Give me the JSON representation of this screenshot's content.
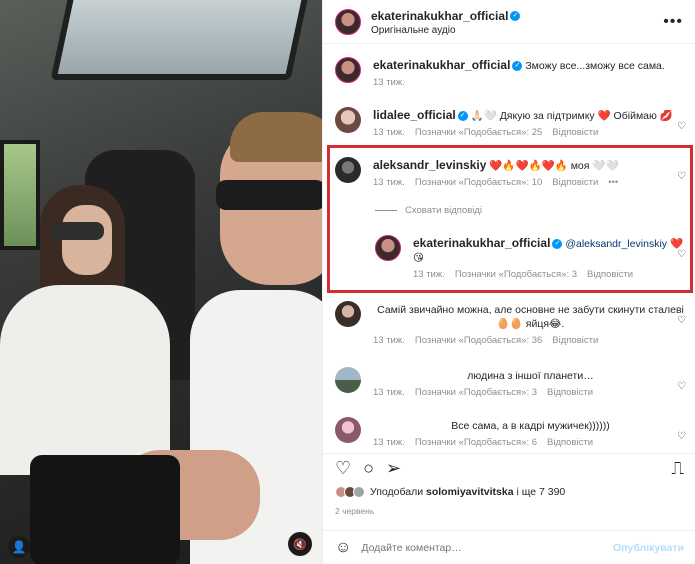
{
  "post": {
    "username": "ekaterinakukhar_official",
    "audio": "Оригінальне аудіо",
    "more": "•••"
  },
  "comments": [
    {
      "username": "ekaterinakukhar_official",
      "text": "Зможу все...зможу все сама.",
      "time": "13 тиж."
    },
    {
      "username": "lidalee_official",
      "text": "🙏🏻🤍 Дякую за підтримку ❤️ Обіймаю 💋",
      "time": "13 тиж.",
      "likes": "Позначки «Подобається»: 25",
      "reply": "Відповісти"
    },
    {
      "username": "aleksandr_levinskiy",
      "text": "❤️🔥❤️🔥❤️🔥 моя 🤍🤍",
      "time": "13 тиж.",
      "likes": "Позначки «Подобається»: 10",
      "reply": "Відповісти"
    },
    {
      "username": "",
      "text": "Самій звичайно можна, але основне не забути скинути сталеві🥚🥚 яйця😂.",
      "time": "13 тиж.",
      "likes": "Позначки «Подобається»: 36",
      "reply": "Відповісти"
    },
    {
      "username": "",
      "text": "людина з іншої планети…",
      "time": "13 тиж.",
      "likes": "Позначки «Подобається»: 3",
      "reply": "Відповісти"
    },
    {
      "username": "",
      "text": "Все сама, а в кадрі мужичек))))))",
      "time": "13 тиж.",
      "likes": "Позначки «Подобається»: 6",
      "reply": "Відповісти"
    }
  ],
  "hide_replies": "Сховати відповіді",
  "reply": {
    "username": "ekaterinakukhar_official",
    "mention": "@aleksandr_levinskiy",
    "text": "❤️ 😘",
    "time": "13 тиж.",
    "likes": "Позначки «Подобається»: 3",
    "reply": "Відповісти"
  },
  "likes_summary": {
    "prefix": "Уподобали ",
    "user": "solomiyavitvitska",
    "suffix": " і ще 7 390"
  },
  "date": "2 червень",
  "add_comment": {
    "placeholder": "Додайте коментар…",
    "publish": "Опублікувати"
  },
  "colors": {
    "highlight": "#d32d31",
    "verified": "#0095f6",
    "heart": "#ed1c24"
  }
}
